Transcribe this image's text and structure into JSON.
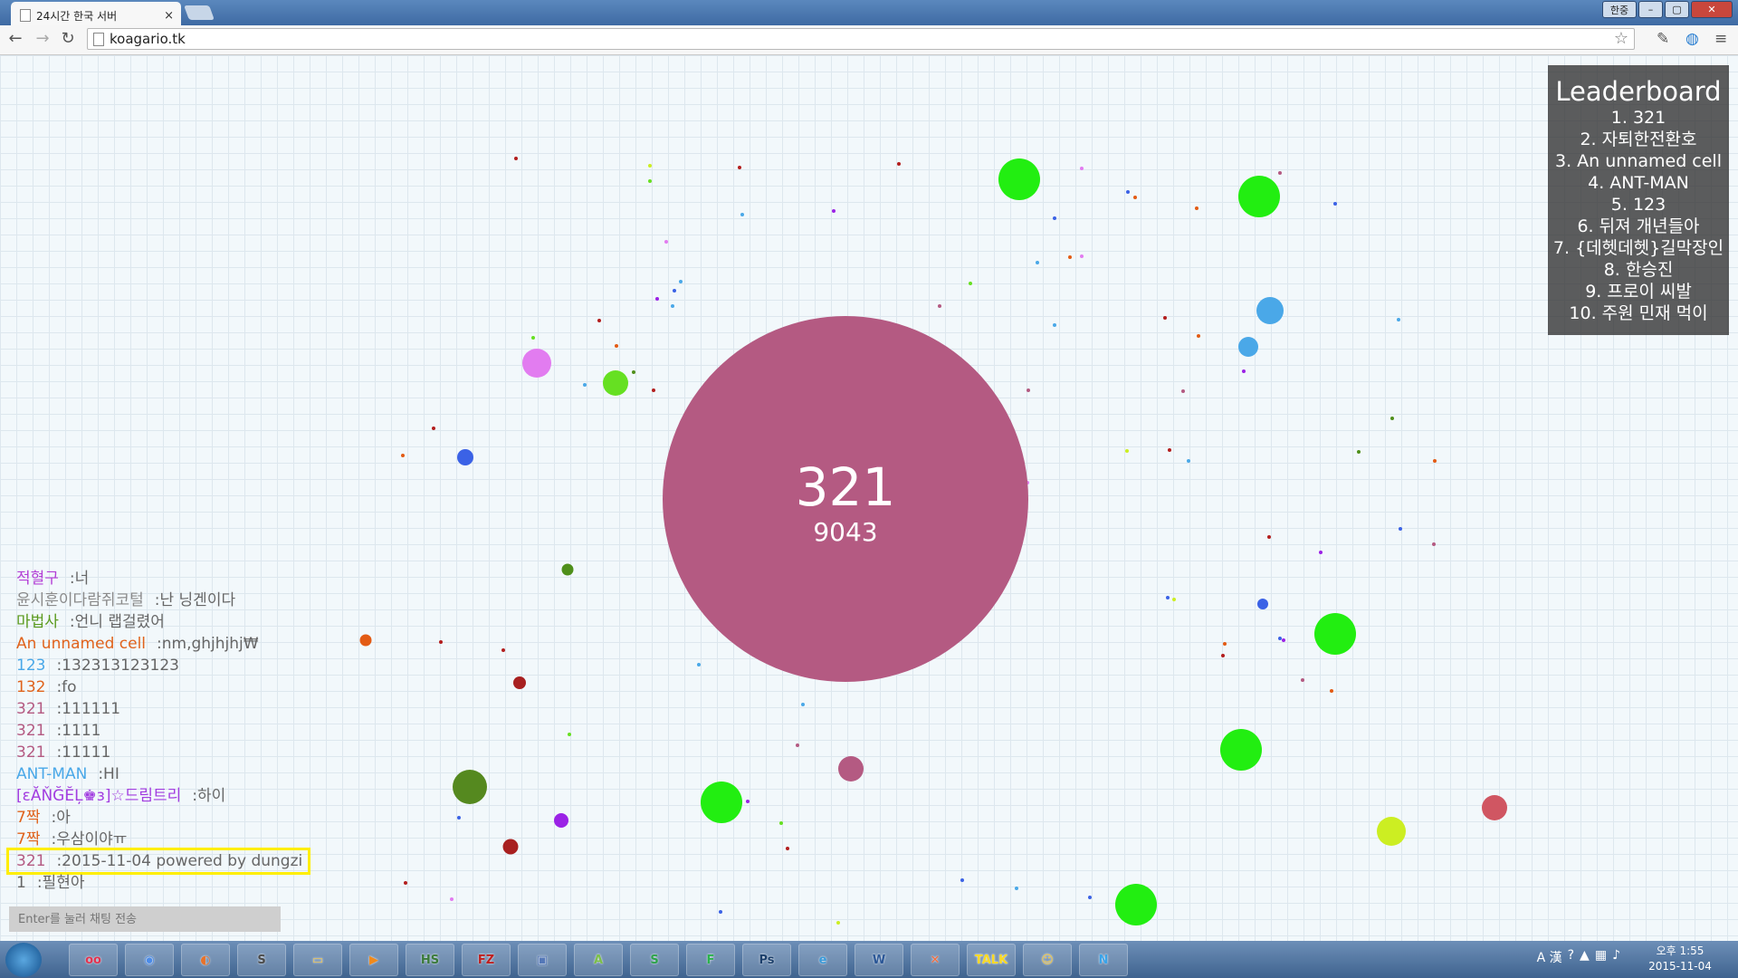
{
  "browser": {
    "tab_title": "24시간 한국 서버",
    "tab_close": "×",
    "url": "koagario.tk",
    "window_lang": "한중"
  },
  "game": {
    "player": {
      "name": "321",
      "mass": "9043",
      "color": "#b45a82"
    },
    "leaderboard": {
      "title": "Leaderboard",
      "entries": [
        "1. 321",
        "2. 자퇴한전환호",
        "3. An unnamed cell",
        "4. ANT-MAN",
        "5. 123",
        "6. 뒤져 개년들아",
        "7. {데헷데헷}길막장인",
        "8. 한승진",
        "9. 프로이 씨발",
        "10. 주원 민재 먹이"
      ]
    }
  },
  "chat": {
    "messages": [
      {
        "name": "적혈구",
        "text": ":너",
        "color": "#b33fd6"
      },
      {
        "name": "윤시훈이다람쥐코털",
        "text": ":난 닝겐이다",
        "color": "#8a8a8a"
      },
      {
        "name": "마법사",
        "text": ":언니 랩걸렸어",
        "color": "#5a9a1e"
      },
      {
        "name": "An unnamed cell",
        "text": ":nm,ghjhjhj₩",
        "color": "#e0631c"
      },
      {
        "name": "123",
        "text": ":132313123123",
        "color": "#4aa8e8"
      },
      {
        "name": "132",
        "text": ":fo",
        "color": "#e0631c"
      },
      {
        "name": "321",
        "text": ":111111",
        "color": "#b45a82"
      },
      {
        "name": "321",
        "text": ":1111",
        "color": "#b45a82"
      },
      {
        "name": "321",
        "text": ":11111",
        "color": "#b45a82"
      },
      {
        "name": "ANT-MAN",
        "text": ":HI",
        "color": "#4aa8e8"
      },
      {
        "name": "[εĂŇĞĔĻ♚з]☆드림트리",
        "text": ":하이",
        "color": "#a23de0"
      },
      {
        "name": "7짝",
        "text": ":아",
        "color": "#e0631c"
      },
      {
        "name": "7짝",
        "text": ":우삼이야ㅠ",
        "color": "#e0631c"
      },
      {
        "name": "321",
        "text": ":2015-11-04 powered by dungzi",
        "color": "#b45a82",
        "highlight": true
      },
      {
        "name": "1",
        "text": ":필현아",
        "color": "#666666"
      }
    ],
    "input_placeholder": "Enter를 눌러 채팅 전송"
  },
  "taskbar": {
    "apps": [
      {
        "name": "ocam",
        "label": "oo",
        "color": "#e2334f"
      },
      {
        "name": "chrome",
        "label": "◉",
        "color": "#4b8be8"
      },
      {
        "name": "firefox",
        "label": "◐",
        "color": "#e8722a"
      },
      {
        "name": "sublime",
        "label": "S",
        "color": "#4a4a4a"
      },
      {
        "name": "explorer",
        "label": "▭",
        "color": "#e8c35a"
      },
      {
        "name": "mediaplayer",
        "label": "▶",
        "color": "#f08a1c"
      },
      {
        "name": "heidisql",
        "label": "HS",
        "color": "#3a7a3a"
      },
      {
        "name": "filezilla",
        "label": "FZ",
        "color": "#bf1f1f"
      },
      {
        "name": "virtualbox",
        "label": "▣",
        "color": "#5578b8"
      },
      {
        "name": "android-studio",
        "label": "A",
        "color": "#7cbf4a"
      },
      {
        "name": "slides",
        "label": "S",
        "color": "#2ca24a"
      },
      {
        "name": "feedly",
        "label": "F",
        "color": "#2bb24c"
      },
      {
        "name": "photoshop",
        "label": "Ps",
        "color": "#1b3f6b"
      },
      {
        "name": "ie",
        "label": "e",
        "color": "#3a9ad9"
      },
      {
        "name": "word",
        "label": "W",
        "color": "#2b5797"
      },
      {
        "name": "xampp",
        "label": "✕",
        "color": "#f36a3a"
      },
      {
        "name": "kakaotalk",
        "label": "TALK",
        "color": "#f9d923"
      },
      {
        "name": "messenger",
        "label": "☺",
        "color": "#f7c73a"
      },
      {
        "name": "naver",
        "label": "N",
        "color": "#3aa3e8"
      }
    ],
    "tray_ime": "A 漢",
    "clock_time": "오후 1:55",
    "clock_date": "2015-11-04"
  }
}
